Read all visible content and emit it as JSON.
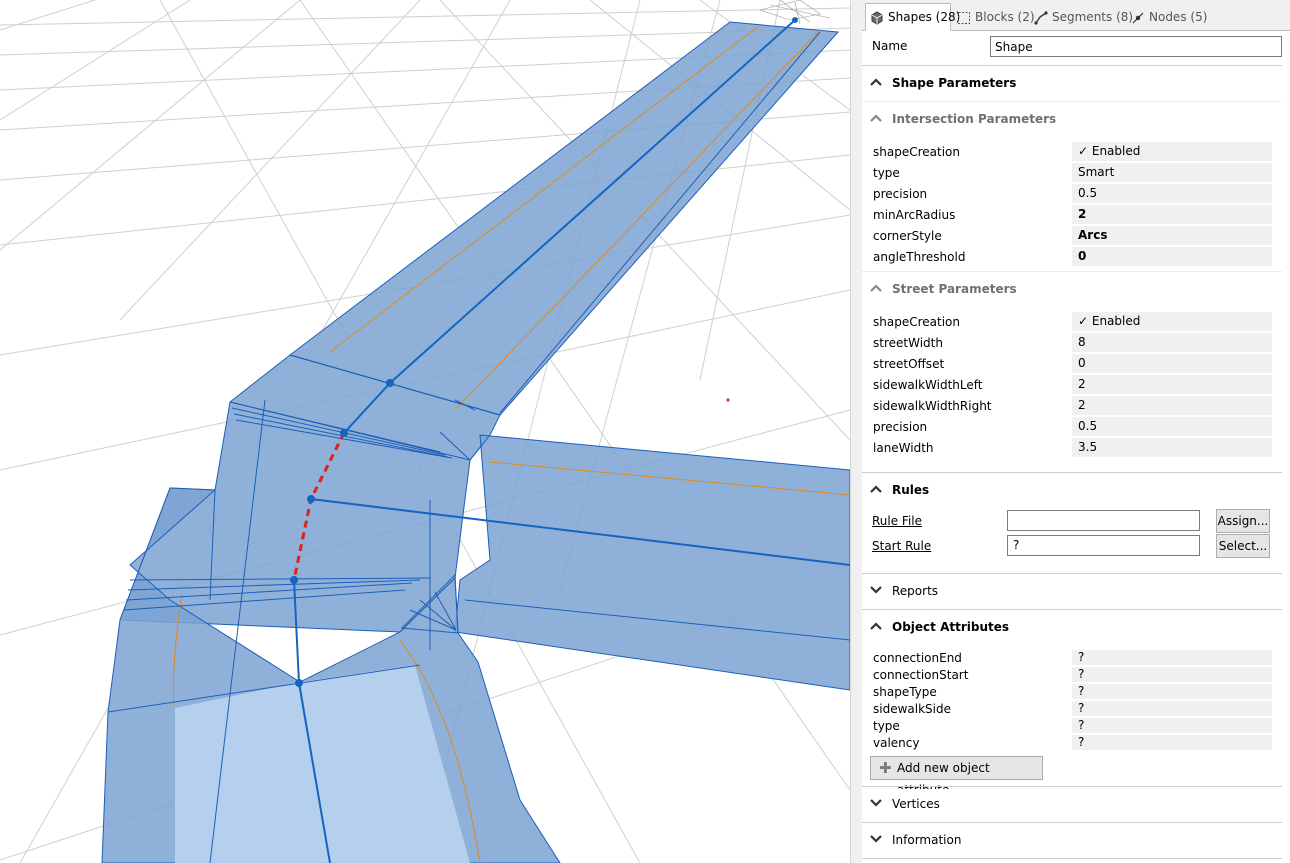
{
  "tabs": [
    {
      "label": "Shapes (28)",
      "icon": "shapes-icon"
    },
    {
      "label": "Blocks (2)",
      "icon": "blocks-icon"
    },
    {
      "label": "Segments (8)",
      "icon": "segments-icon"
    },
    {
      "label": "Nodes (5)",
      "icon": "nodes-icon"
    }
  ],
  "name_row": {
    "label": "Name",
    "value": "Shape"
  },
  "shape_parameters": {
    "title": "Shape Parameters"
  },
  "intersection": {
    "title": "Intersection Parameters",
    "rows": [
      {
        "key": "shapeCreation",
        "value": "✓ Enabled"
      },
      {
        "key": "type",
        "value": "Smart"
      },
      {
        "key": "precision",
        "value": "0.5"
      },
      {
        "key": "minArcRadius",
        "value": "2"
      },
      {
        "key": "cornerStyle",
        "value": "Arcs"
      },
      {
        "key": "angleThreshold",
        "value": "0"
      }
    ]
  },
  "street": {
    "title": "Street Parameters",
    "rows": [
      {
        "key": "shapeCreation",
        "value": "✓ Enabled"
      },
      {
        "key": "streetWidth",
        "value": "8"
      },
      {
        "key": "streetOffset",
        "value": "0"
      },
      {
        "key": "sidewalkWidthLeft",
        "value": "2"
      },
      {
        "key": "sidewalkWidthRight",
        "value": "2"
      },
      {
        "key": "precision",
        "value": "0.5"
      },
      {
        "key": "laneWidth",
        "value": "3.5"
      }
    ]
  },
  "rules": {
    "title": "Rules",
    "rule_file_label": "Rule File",
    "rule_file_value": "",
    "assign_button": "Assign...",
    "start_rule_label": "Start Rule",
    "start_rule_value": "?",
    "select_button": "Select..."
  },
  "reports": {
    "title": "Reports"
  },
  "object_attributes": {
    "title": "Object Attributes",
    "rows": [
      {
        "key": "connectionEnd",
        "value": "?"
      },
      {
        "key": "connectionStart",
        "value": "?"
      },
      {
        "key": "shapeType",
        "value": "?"
      },
      {
        "key": "sidewalkSide",
        "value": "?"
      },
      {
        "key": "type",
        "value": "?"
      },
      {
        "key": "valency",
        "value": "?"
      }
    ],
    "add_button": "Add new object attribute..."
  },
  "vertices": {
    "title": "Vertices"
  },
  "information": {
    "title": "Information"
  },
  "colors": {
    "street_fill": "#7ba3d2",
    "street_fill_light": "#b9d4ee",
    "street_edge": "#1c5fb8",
    "centerline": "#1565c0",
    "sidewalk_line": "#e08a1e",
    "selected_edge": "#e0201a",
    "grid": "#cfcfcf"
  }
}
